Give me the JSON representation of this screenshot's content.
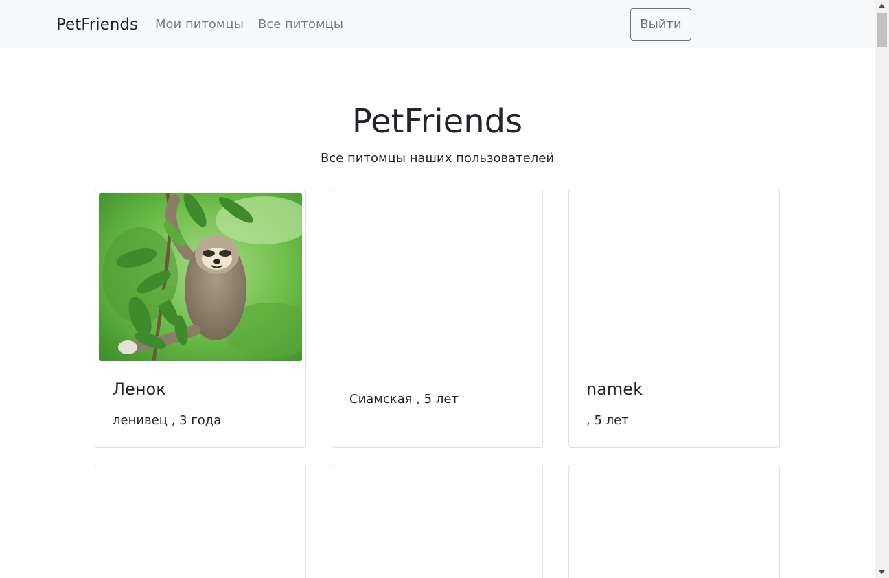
{
  "navbar": {
    "brand": "PetFriends",
    "links": [
      {
        "label": "Мои питомцы"
      },
      {
        "label": "Все питомцы"
      }
    ],
    "logout_label": "Выйти"
  },
  "header": {
    "title": "PetFriends",
    "subtitle": "Все питомцы наших пользователей"
  },
  "pets": [
    {
      "name": "Ленок",
      "details": "ленивец , 3 года",
      "has_photo": true,
      "photo": "sloth-hanging-on-branch"
    },
    {
      "name": "",
      "details": "Сиамская , 5 лет",
      "has_photo": false
    },
    {
      "name": "namek",
      "details": ", 5 лет",
      "has_photo": false
    },
    {
      "name": "",
      "details": "",
      "has_photo": false
    },
    {
      "name": "",
      "details": "",
      "has_photo": false
    },
    {
      "name": "",
      "details": "",
      "has_photo": false
    }
  ],
  "colors": {
    "navbar_bg": "#f8f9fa",
    "nav_link": "#7a7c7f",
    "button_border": "#6c757d",
    "card_border": "#dcdfe2",
    "scrollbar_track": "#f1f1f1",
    "scrollbar_thumb": "#c1c1c1"
  },
  "scrollbar": {
    "up_icon": "triangle-up-icon",
    "down_icon": "triangle-down-icon"
  }
}
